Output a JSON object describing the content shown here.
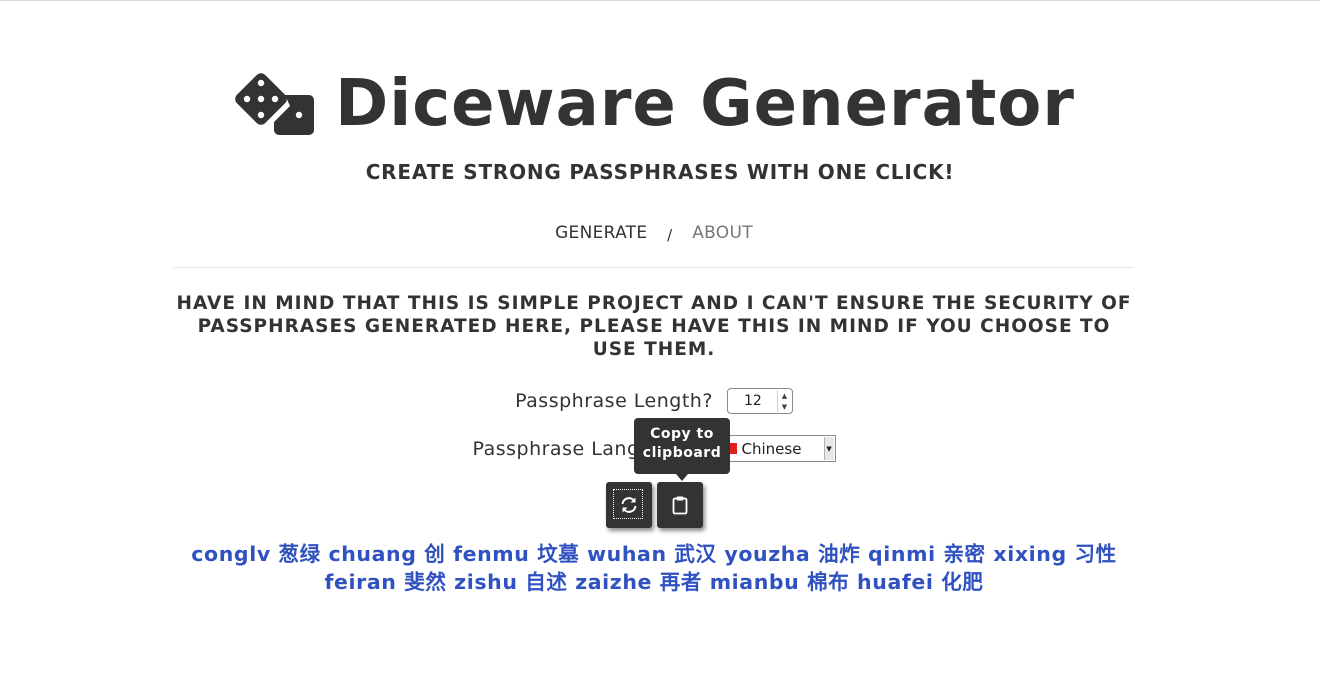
{
  "header": {
    "title": "Diceware Generator",
    "logo_icon": "dice-icon",
    "subtitle": "CREATE STRONG PASSPHRASES WITH ONE CLICK!"
  },
  "nav": {
    "items": [
      {
        "label": "GENERATE",
        "active": true
      },
      {
        "label": "ABOUT",
        "active": false
      }
    ],
    "separator": "/"
  },
  "warning": "HAVE IN MIND THAT THIS IS SIMPLE PROJECT AND I CAN'T ENSURE THE SECURITY OF PASSPHRASES GENERATED HERE, PLEASE HAVE THIS IN MIND IF YOU CHOOSE TO USE THEM.",
  "form": {
    "length_label": "Passphrase Length?",
    "length_value": "12",
    "language_label_visible": "Passphrase Lang",
    "language_value": "Chinese"
  },
  "tooltip": {
    "line1": "Copy to",
    "line2": "clipboard"
  },
  "buttons": {
    "refresh_icon": "refresh-icon",
    "copy_icon": "clipboard-icon"
  },
  "passphrase": {
    "line1": "conglv 葱绿 chuang 创 fenmu 坟墓 wuhan 武汉 youzha 油炸 qinmi 亲密 xixing 习性",
    "line2": "feiran 斐然 zishu 自述 zaizhe 再者 mianbu 棉布 huafei 化肥"
  },
  "colors": {
    "text": "#333333",
    "link_muted": "#777777",
    "passphrase": "#3052c0",
    "button_bg": "#333333",
    "flag_red": "#e0201b"
  }
}
